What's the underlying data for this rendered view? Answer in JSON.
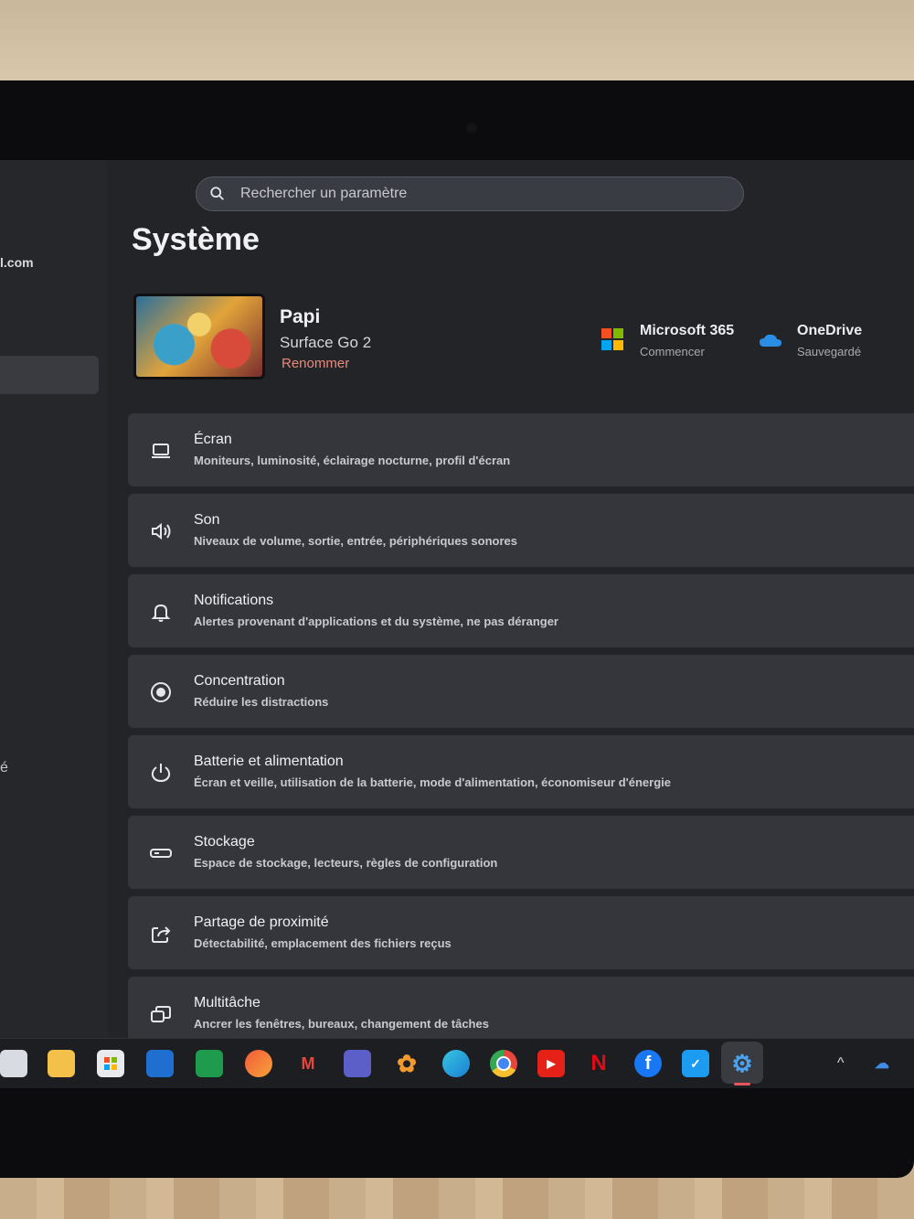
{
  "search": {
    "placeholder": "Rechercher un paramètre"
  },
  "sidebar": {
    "email_fragment": "l.com",
    "partial_item": "é"
  },
  "page": {
    "title": "Système"
  },
  "device": {
    "name": "Papi",
    "model": "Surface Go 2",
    "rename_label": "Renommer"
  },
  "quick_links": [
    {
      "title": "Microsoft 365",
      "subtitle": "Commencer",
      "icon": "microsoft-365-icon"
    },
    {
      "title": "OneDrive",
      "subtitle": "Sauvegardé",
      "icon": "onedrive-icon"
    }
  ],
  "settings": [
    {
      "title": "Écran",
      "subtitle": "Moniteurs, luminosité, éclairage nocturne, profil d'écran",
      "icon": "display-icon"
    },
    {
      "title": "Son",
      "subtitle": "Niveaux de volume, sortie, entrée, périphériques sonores",
      "icon": "speaker-icon"
    },
    {
      "title": "Notifications",
      "subtitle": "Alertes provenant d'applications et du système, ne pas déranger",
      "icon": "bell-icon"
    },
    {
      "title": "Concentration",
      "subtitle": "Réduire les distractions",
      "icon": "focus-icon"
    },
    {
      "title": "Batterie et alimentation",
      "subtitle": "Écran et veille, utilisation de la batterie, mode d'alimentation, économiseur d'énergie",
      "icon": "power-icon"
    },
    {
      "title": "Stockage",
      "subtitle": "Espace de stockage, lecteurs, règles de configuration",
      "icon": "storage-icon"
    },
    {
      "title": "Partage de proximité",
      "subtitle": "Détectabilité, emplacement des fichiers reçus",
      "icon": "share-icon"
    },
    {
      "title": "Multitâche",
      "subtitle": "Ancrer les fenêtres, bureaux, changement de tâches",
      "icon": "multitask-icon"
    }
  ],
  "taskbar": {
    "apps": [
      "task-view",
      "file-explorer",
      "microsoft-store",
      "outlook",
      "excel",
      "photos",
      "gmail",
      "teams",
      "settings-flower",
      "edge",
      "chrome",
      "youtube",
      "netflix",
      "facebook",
      "twitter",
      "settings"
    ],
    "active": "settings"
  },
  "colors": {
    "accent_rename": "#e88a7c",
    "background": "#232428",
    "card": "#35363c"
  }
}
